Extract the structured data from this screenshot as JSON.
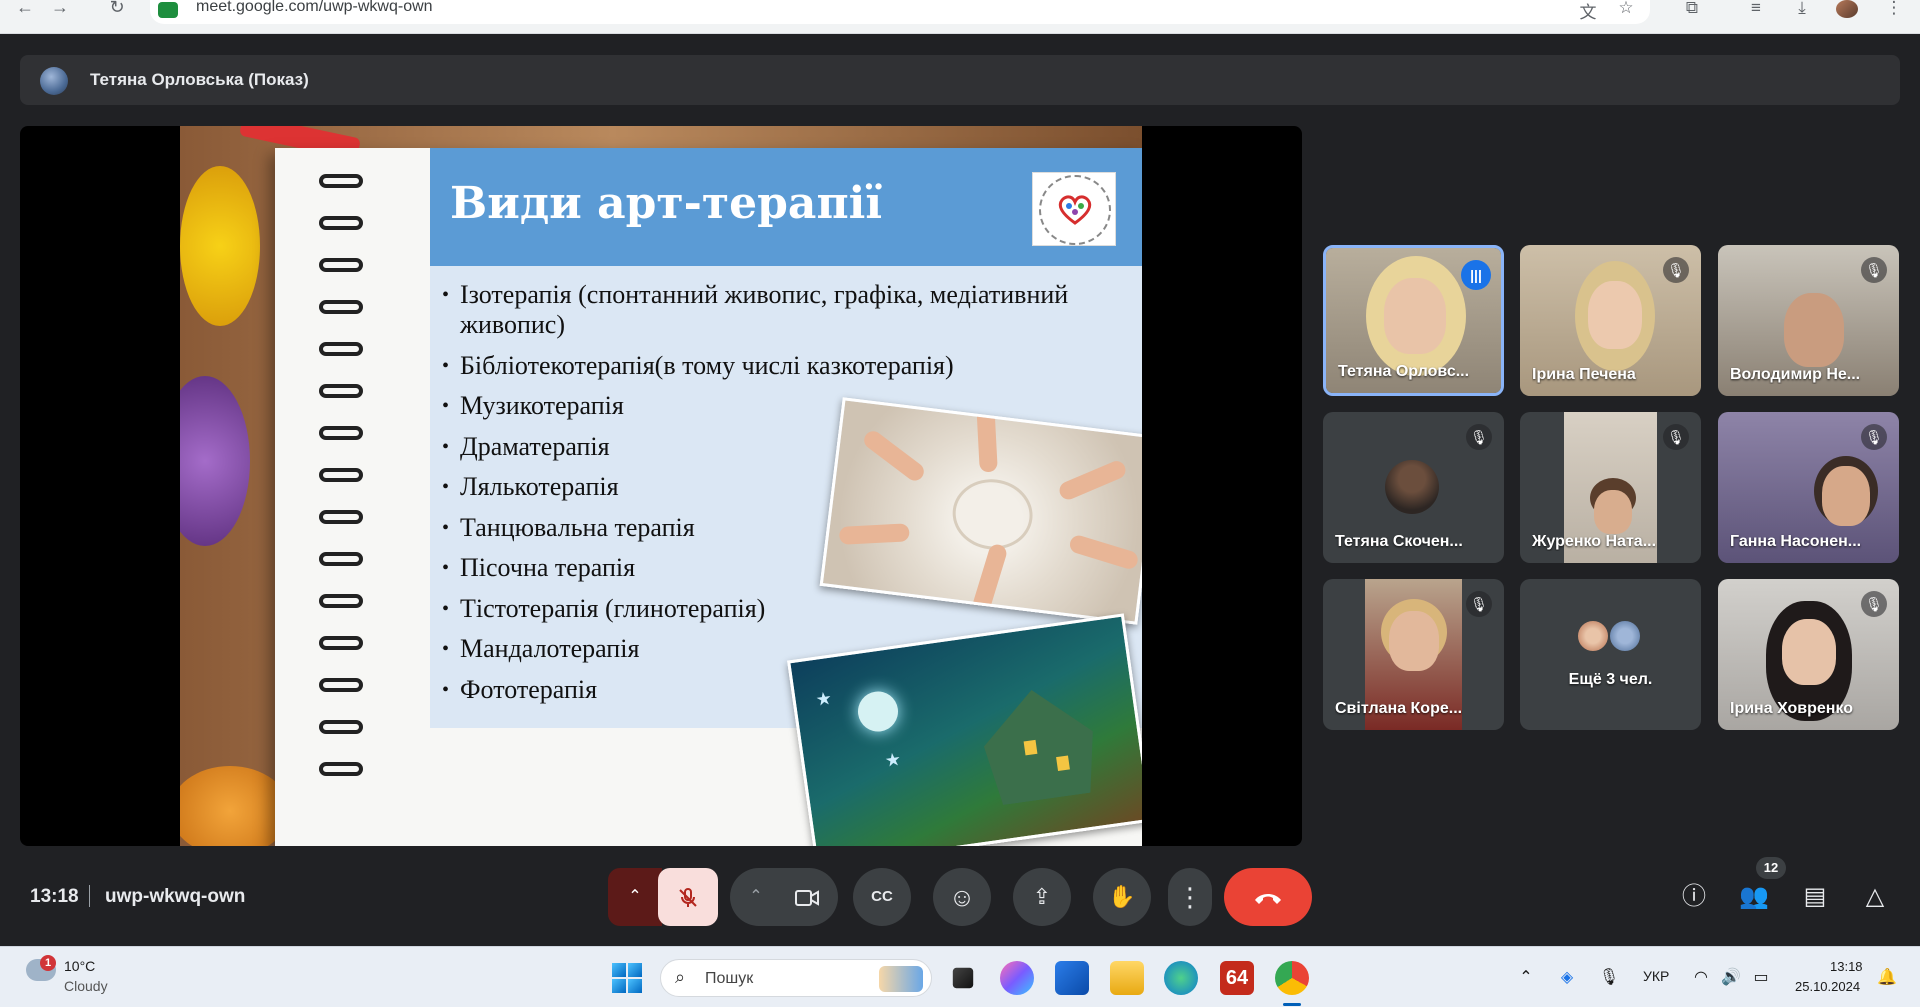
{
  "browser": {
    "url": "meet.google.com/uwp-wkwq-own",
    "back_icon": "←",
    "forward_icon": "→",
    "reload_icon": "↻",
    "translate_icon": "文",
    "bookmark_icon": "☆",
    "extensions_icon": "⧉",
    "media_icon": "≡",
    "download_icon": "⤓",
    "menu_icon": "⋮"
  },
  "presenter": {
    "name": "Тетяна Орловська (Показ)"
  },
  "slide": {
    "title": "Види арт-терапії",
    "bullets": [
      "Ізотерапія (спонтанний живопис, графіка, медіативний живопис)",
      "Бібліотекотерапія(в тому числі казкотерапія)",
      "Музикотерапія",
      "Драматерапія",
      "Лялькотерапія",
      "Танцювальна терапія",
      "Пісочна терапія",
      "Тістотерапія (глинотерапія)",
      "Мандалотерапія",
      "Фототерапія"
    ]
  },
  "participants": [
    {
      "name": "Тетяна Орловс...",
      "status": "speaking"
    },
    {
      "name": "Ірина Печена",
      "status": "muted"
    },
    {
      "name": "Володимир Не...",
      "status": "muted"
    },
    {
      "name": "Тетяна Скочен...",
      "status": "muted"
    },
    {
      "name": "Журенко Ната...",
      "status": "muted"
    },
    {
      "name": "Ганна Насонен...",
      "status": "muted"
    },
    {
      "name": "Світлана Коре...",
      "status": "muted"
    },
    {
      "name": "Ещё 3 чел.",
      "status": "others"
    },
    {
      "name": "Ірина Ховренко",
      "status": "muted"
    }
  ],
  "meeting": {
    "time": "13:18",
    "code": "uwp-wkwq-own",
    "people_count": "12"
  },
  "controls": {
    "chevron_icon": "⌃",
    "mic_off_icon": "🎙",
    "camera_icon": "▭",
    "captions_icon": "CC",
    "emoji_icon": "☺",
    "present_icon": "⇪",
    "raise_hand_icon": "✋",
    "more_icon": "⋮",
    "end_call_icon": "☎",
    "info_icon": "ⓘ",
    "people_icon": "👥",
    "chat_icon": "▤",
    "activities_icon": "△"
  },
  "taskbar": {
    "weather_temp": "10°C",
    "weather_desc": "Cloudy",
    "weather_badge": "1",
    "search_placeholder": "Пошук",
    "app_64_label": "64",
    "lang": "УКР",
    "clock_time": "13:18",
    "clock_date": "25.10.2024"
  },
  "colors": {
    "meet_bg": "#202124",
    "tile_bg": "#3c4043",
    "end_call": "#ea4335",
    "speaking_border": "#8ab4f8",
    "slide_title_band": "#5b9bd5",
    "slide_content_band": "#dbe7f4"
  }
}
